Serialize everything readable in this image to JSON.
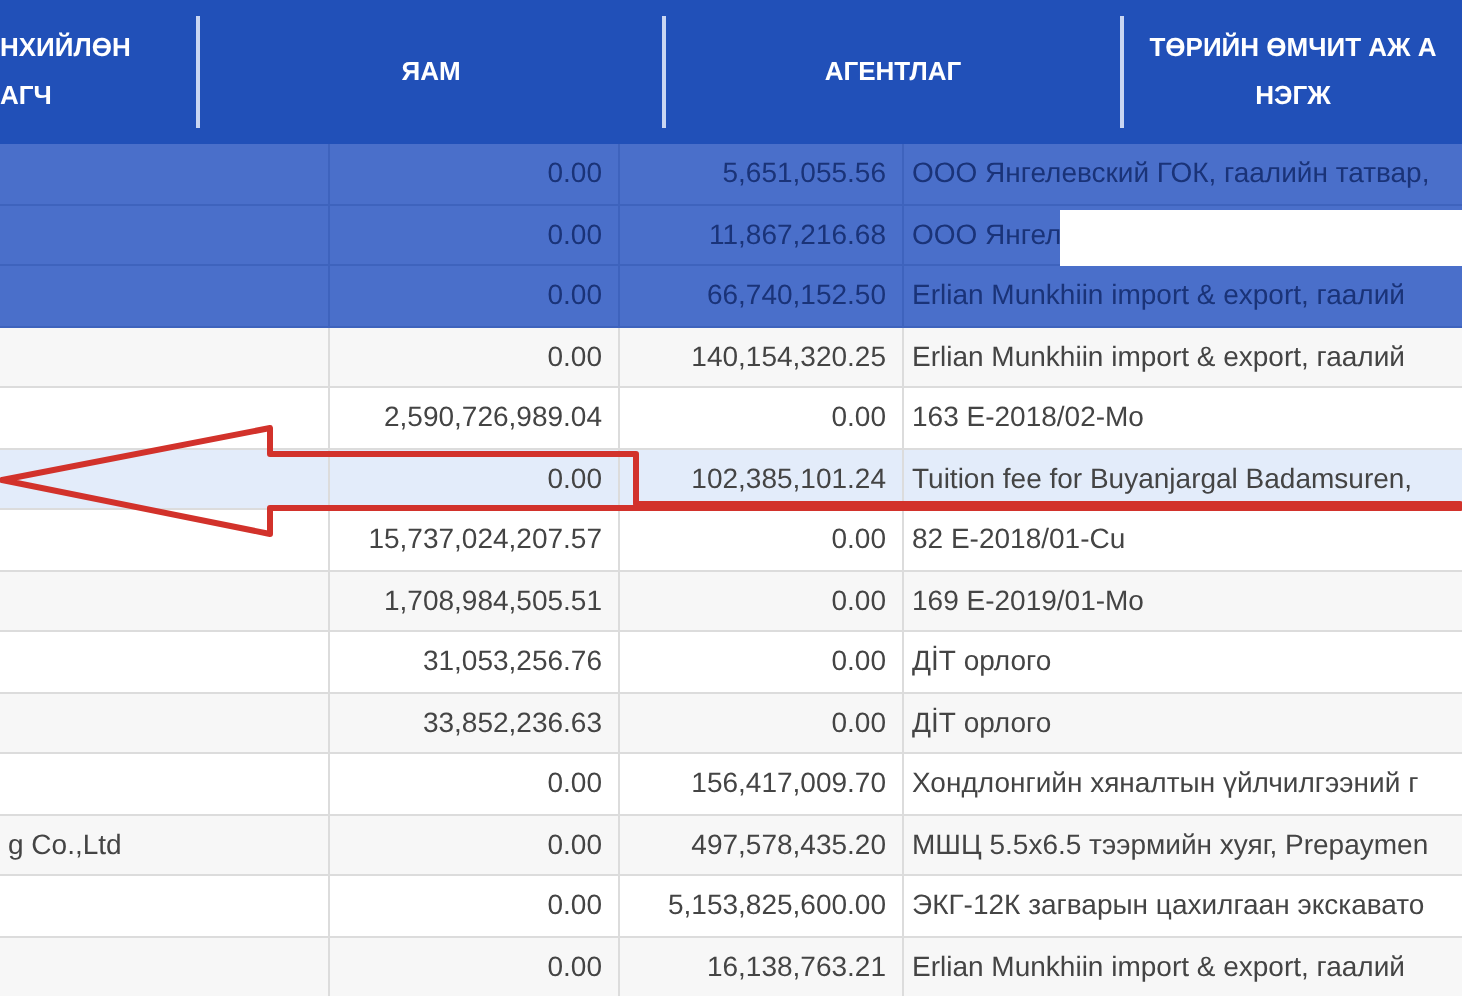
{
  "header": {
    "columns": [
      {
        "lines": [
          "НХИЙЛӨН",
          "АГЧ"
        ]
      },
      {
        "lines": [
          "ЯАМ"
        ]
      },
      {
        "lines": [
          "АГЕНТЛАГ"
        ]
      },
      {
        "lines": [
          "ТӨРИЙН ӨМЧИТ АЖ А",
          "НЭГЖ"
        ]
      }
    ]
  },
  "rows": [
    {
      "kind": "tinted",
      "redacted": false,
      "selected": false,
      "cells": [
        "",
        "0.00",
        "5,651,055.56",
        "ООО Янгелевский ГОК, гаалийн татвар,"
      ]
    },
    {
      "kind": "tinted",
      "redacted": true,
      "selected": false,
      "cells": [
        "",
        "0.00",
        "11,867,216.68",
        "ООО Янгел"
      ]
    },
    {
      "kind": "tinted",
      "redacted": false,
      "selected": false,
      "cells": [
        "",
        "0.00",
        "66,740,152.50",
        "Erlian Munkhiin import & export, гаалий"
      ]
    },
    {
      "kind": "plain",
      "redacted": false,
      "selected": false,
      "cells": [
        "",
        "0.00",
        "140,154,320.25",
        "Erlian Munkhiin import & export, гаалий"
      ]
    },
    {
      "kind": "plain",
      "redacted": false,
      "selected": false,
      "cells": [
        "",
        "2,590,726,989.04",
        "0.00",
        "163 E-2018/02-Mo"
      ]
    },
    {
      "kind": "plain",
      "redacted": false,
      "selected": true,
      "cells": [
        "",
        "0.00",
        "102,385,101.24",
        "Tuition fee for Buyanjargal Badamsuren,"
      ]
    },
    {
      "kind": "plain",
      "redacted": false,
      "selected": false,
      "cells": [
        "",
        "15,737,024,207.57",
        "0.00",
        "82 E-2018/01-Cu"
      ]
    },
    {
      "kind": "plain",
      "redacted": false,
      "selected": false,
      "cells": [
        "",
        "1,708,984,505.51",
        "0.00",
        "169 E-2019/01-Mo"
      ]
    },
    {
      "kind": "plain",
      "redacted": false,
      "selected": false,
      "cells": [
        "",
        "31,053,256.76",
        "0.00",
        "ДİТ орлого"
      ]
    },
    {
      "kind": "plain",
      "redacted": false,
      "selected": false,
      "cells": [
        "",
        "33,852,236.63",
        "0.00",
        "ДİТ орлого"
      ]
    },
    {
      "kind": "plain",
      "redacted": false,
      "selected": false,
      "cells": [
        "",
        "0.00",
        "156,417,009.70",
        "Хондлонгийн хяналтын үйлчилгээний г"
      ]
    },
    {
      "kind": "plain",
      "redacted": false,
      "selected": false,
      "cells": [
        "g Co.,Ltd",
        "0.00",
        "497,578,435.20",
        "МШЦ 5.5x6.5 тээрмийн хуяг, Prepaymen"
      ]
    },
    {
      "kind": "plain",
      "redacted": false,
      "selected": false,
      "cells": [
        "",
        "0.00",
        "5,153,825,600.00",
        "ЭКГ-12К загварын цахилгаан экскавато"
      ]
    },
    {
      "kind": "plain",
      "redacted": false,
      "selected": false,
      "cells": [
        "",
        "0.00",
        "16,138,763.21",
        "Erlian Munkhiin import & export, гаалий"
      ]
    }
  ]
}
